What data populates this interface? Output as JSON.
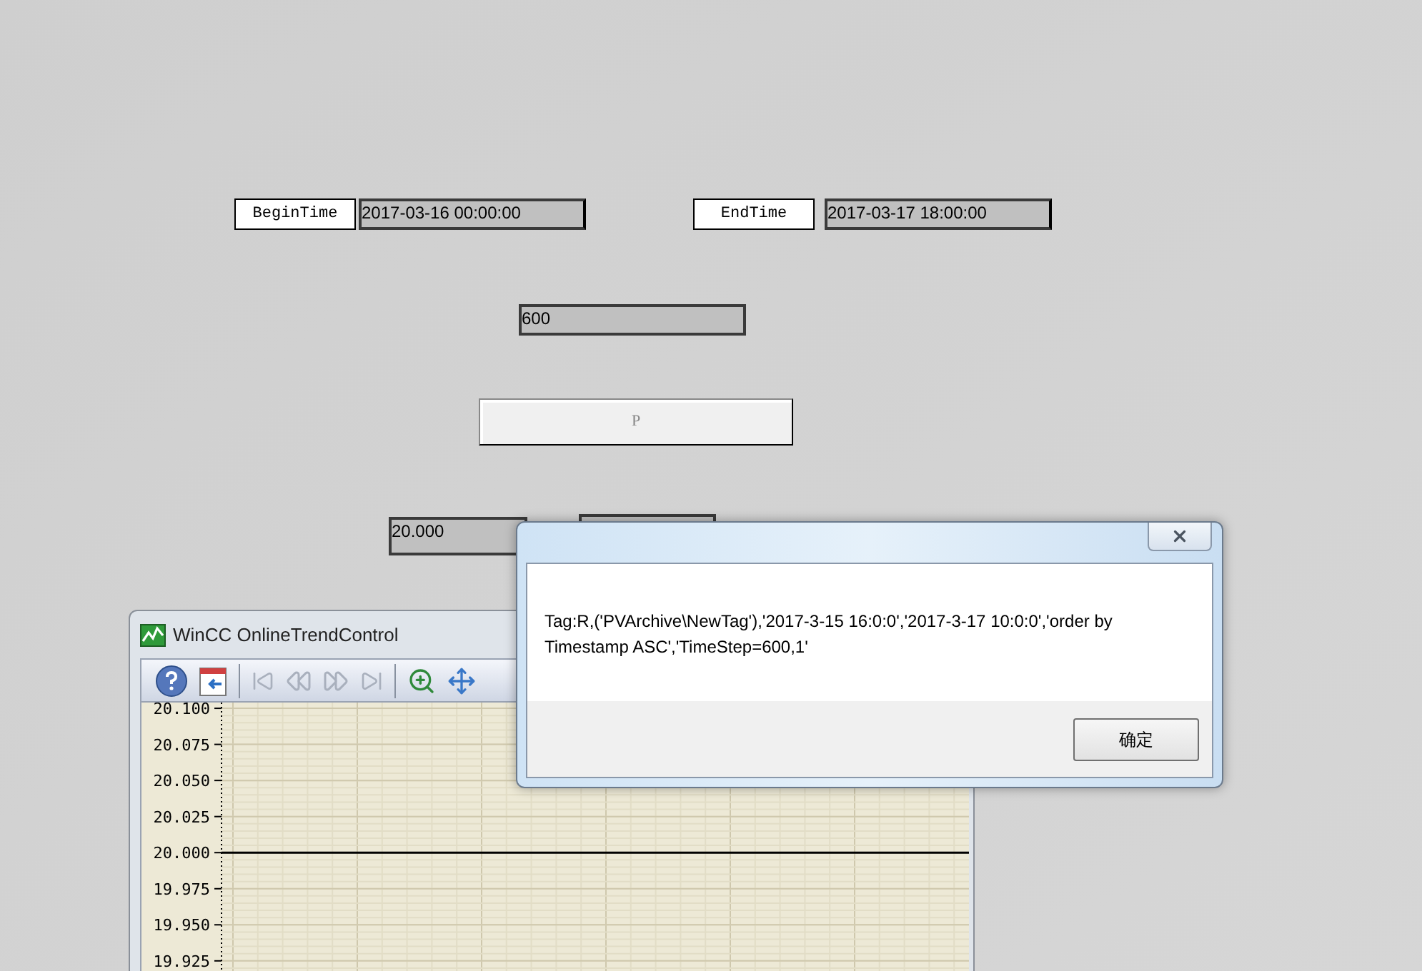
{
  "time_fields": [
    {
      "label": "BeginTime",
      "value": "2017-03-16 00:00:00"
    },
    {
      "label": "EndTime",
      "value": "2017-03-17 18:00:00"
    }
  ],
  "step_field": {
    "value": "600"
  },
  "query_button": {
    "label": "P"
  },
  "value_field": {
    "value": "20.000"
  },
  "trend_window": {
    "title": "WinCC OnlineTrendControl",
    "y_axis_labels": [
      "20.100",
      "20.075",
      "20.050",
      "20.025",
      "20.000",
      "19.975",
      "19.950",
      "19.925"
    ]
  },
  "dialog": {
    "message": "Tag:R,('PVArchive\\NewTag'),'2017-3-15 16:0:0','2017-3-17 10:0:0','order by Timestamp ASC','TimeStep=600,1'",
    "ok_button": "确定"
  }
}
